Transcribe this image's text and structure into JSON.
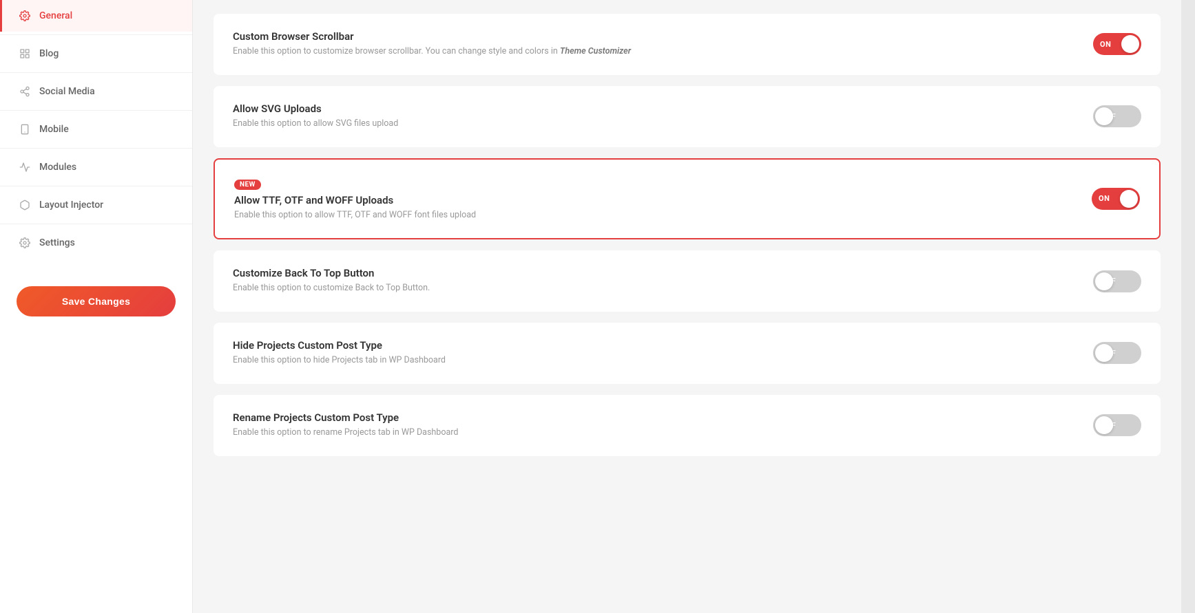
{
  "sidebar": {
    "items": [
      {
        "id": "general",
        "label": "General",
        "icon": "gear",
        "active": true
      },
      {
        "id": "blog",
        "label": "Blog",
        "icon": "grid",
        "active": false
      },
      {
        "id": "social-media",
        "label": "Social Media",
        "icon": "share",
        "active": false
      },
      {
        "id": "mobile",
        "label": "Mobile",
        "icon": "mobile",
        "active": false
      },
      {
        "id": "modules",
        "label": "Modules",
        "icon": "modules",
        "active": false
      },
      {
        "id": "layout-injector",
        "label": "Layout Injector",
        "icon": "layout",
        "active": false
      },
      {
        "id": "settings",
        "label": "Settings",
        "icon": "gear2",
        "active": false
      }
    ],
    "save_button_label": "Save Changes"
  },
  "settings": [
    {
      "id": "custom-browser-scrollbar",
      "title": "Custom Browser Scrollbar",
      "description": "Enable this option to customize browser scrollbar. You can change style and colors in",
      "description_link": "Theme Customizer",
      "toggle": "on",
      "new_badge": false,
      "highlighted": false
    },
    {
      "id": "allow-svg-uploads",
      "title": "Allow SVG Uploads",
      "description": "Enable this option to allow SVG files upload",
      "description_link": "",
      "toggle": "off",
      "new_badge": false,
      "highlighted": false
    },
    {
      "id": "allow-ttf-otf-woff",
      "title": "Allow TTF, OTF and WOFF Uploads",
      "description": "Enable this option to allow TTF, OTF and WOFF font files upload",
      "description_link": "",
      "toggle": "on",
      "new_badge": true,
      "new_badge_label": "NEW",
      "highlighted": true
    },
    {
      "id": "customize-back-to-top",
      "title": "Customize Back To Top Button",
      "description": "Enable this option to customize Back to Top Button.",
      "description_link": "",
      "toggle": "off",
      "new_badge": false,
      "highlighted": false
    },
    {
      "id": "hide-projects-custom-post-type",
      "title": "Hide Projects Custom Post Type",
      "description": "Enable this option to hide Projects tab in WP Dashboard",
      "description_link": "",
      "toggle": "off",
      "new_badge": false,
      "highlighted": false
    },
    {
      "id": "rename-projects-custom-post-type",
      "title": "Rename Projects Custom Post Type",
      "description": "Enable this option to rename Projects tab in WP Dashboard",
      "description_link": "",
      "toggle": "off",
      "new_badge": false,
      "highlighted": false
    }
  ],
  "colors": {
    "accent": "#e53e3e",
    "toggle_on": "#e53e3e",
    "toggle_off": "#c8c8c8"
  }
}
